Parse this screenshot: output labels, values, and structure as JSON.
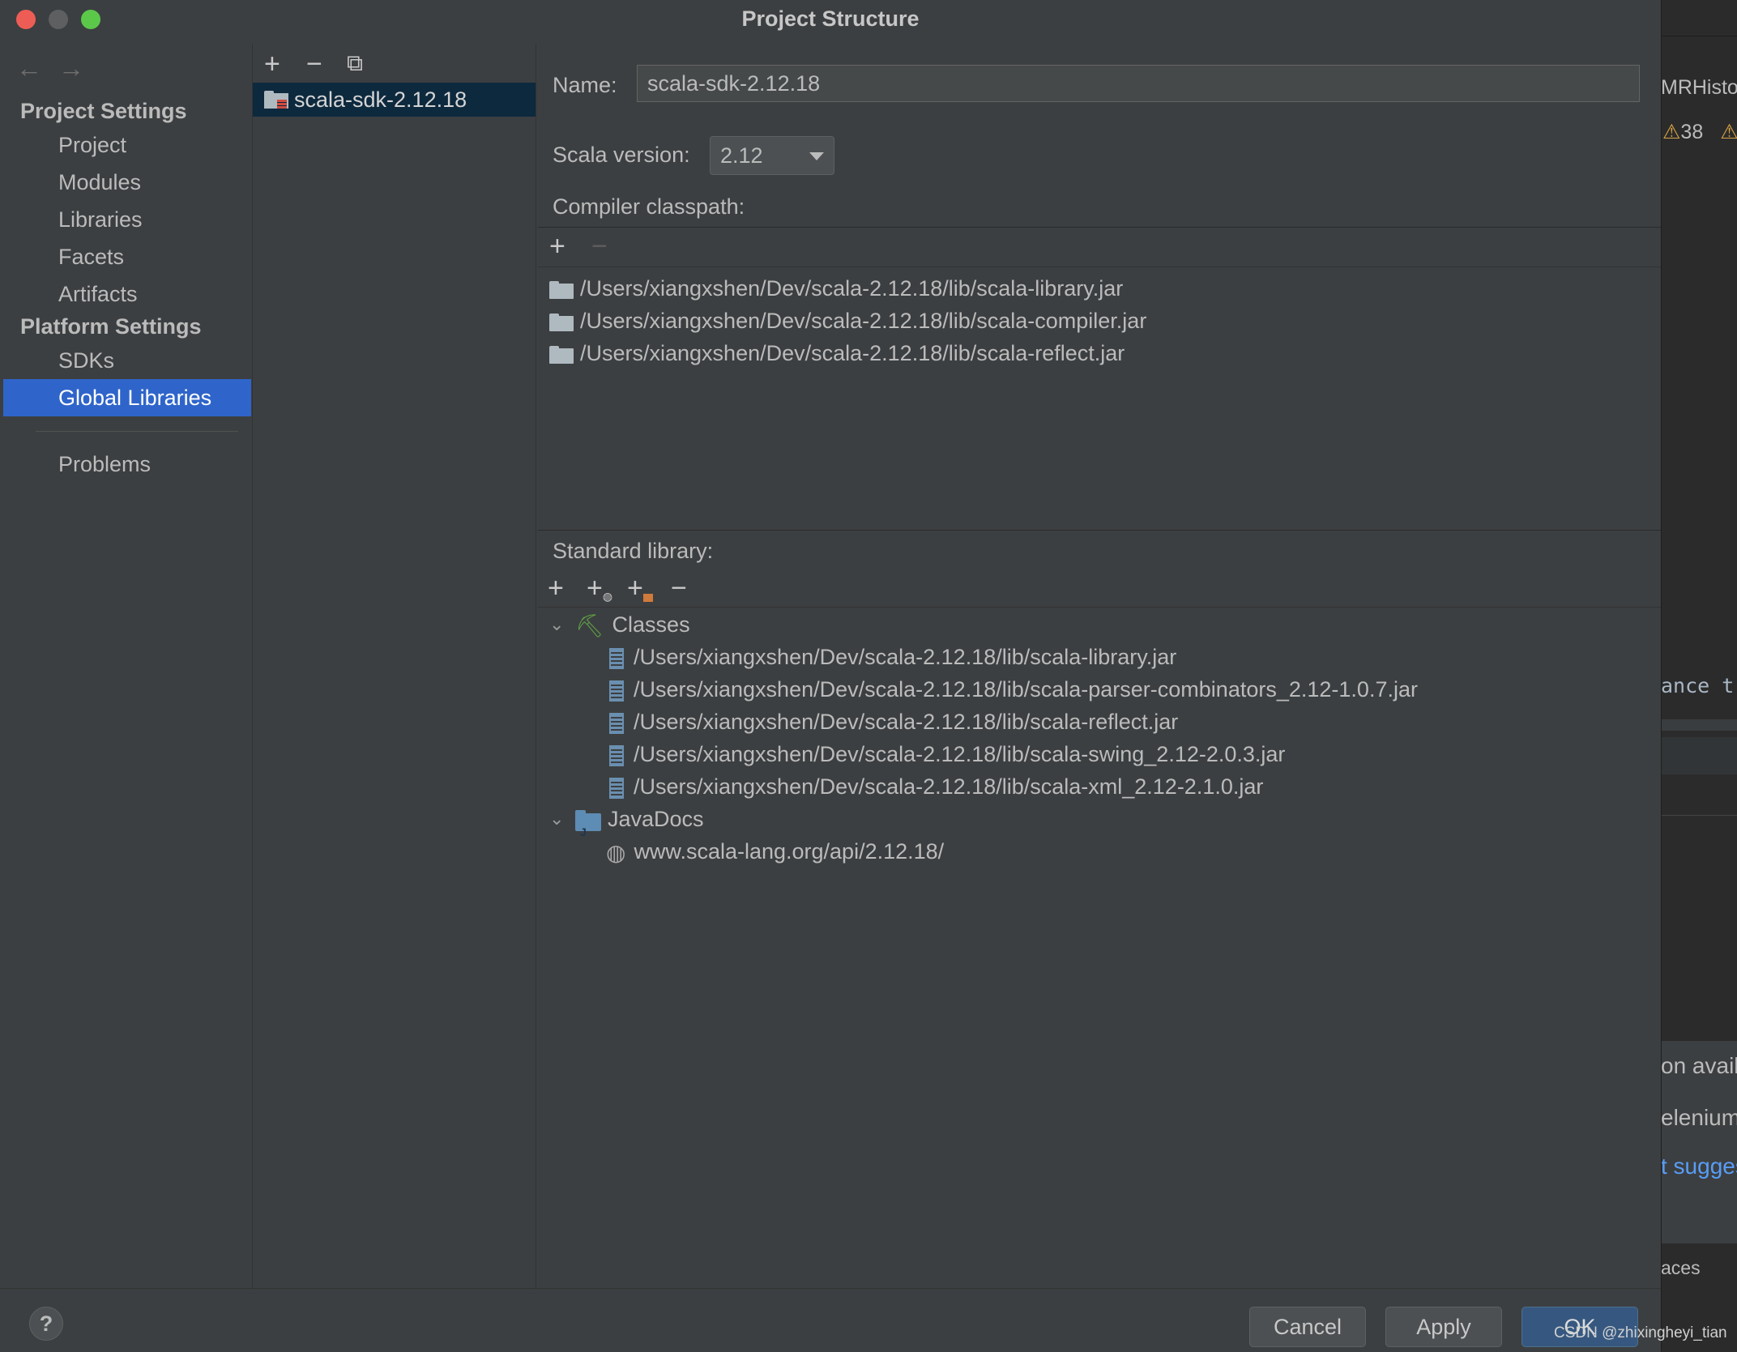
{
  "window": {
    "title": "Project Structure",
    "traffic_lights": {
      "close": "#ee5d55",
      "minimize": "#5d5f61",
      "zoom": "#5cc84a"
    }
  },
  "nav": {
    "back_icon": "←",
    "forward_icon": "→",
    "project_settings_header": "Project Settings",
    "project_items": [
      "Project",
      "Modules",
      "Libraries",
      "Facets",
      "Artifacts"
    ],
    "platform_settings_header": "Platform Settings",
    "platform_items": [
      "SDKs",
      "Global Libraries"
    ],
    "selected": "Global Libraries",
    "problems": "Problems"
  },
  "library_list": {
    "toolbar": {
      "add": "+",
      "remove": "−",
      "copy": "⧉"
    },
    "items": [
      "scala-sdk-2.12.18"
    ]
  },
  "details": {
    "name_label": "Name:",
    "name_value": "scala-sdk-2.12.18",
    "scala_version_label": "Scala version:",
    "scala_version_value": "2.12",
    "compiler_classpath_label": "Compiler classpath:",
    "compiler_classpath": [
      "/Users/xiangxshen/Dev/scala-2.12.18/lib/scala-library.jar",
      "/Users/xiangxshen/Dev/scala-2.12.18/lib/scala-compiler.jar",
      "/Users/xiangxshen/Dev/scala-2.12.18/lib/scala-reflect.jar"
    ],
    "standard_library_label": "Standard library:",
    "classes_label": "Classes",
    "classes": [
      "/Users/xiangxshen/Dev/scala-2.12.18/lib/scala-library.jar",
      "/Users/xiangxshen/Dev/scala-2.12.18/lib/scala-parser-combinators_2.12-1.0.7.jar",
      "/Users/xiangxshen/Dev/scala-2.12.18/lib/scala-reflect.jar",
      "/Users/xiangxshen/Dev/scala-2.12.18/lib/scala-swing_2.12-2.0.3.jar",
      "/Users/xiangxshen/Dev/scala-2.12.18/lib/scala-xml_2.12-2.1.0.jar"
    ],
    "javadocs_label": "JavaDocs",
    "javadocs": [
      "www.scala-lang.org/api/2.12.18/"
    ]
  },
  "buttons": {
    "help": "?",
    "cancel": "Cancel",
    "apply": "Apply",
    "ok": "OK"
  },
  "background_ide": {
    "tab_fragment": "MRHistor",
    "warning_count": "38",
    "code_fragment": "ance t",
    "notif_1": "on availa",
    "notif_2": "elenium",
    "notif_3": "t sugges",
    "status_fragment": "aces"
  },
  "watermark": "CSDN @zhixingheyi_tian",
  "colors": {
    "selection": "#2f65ca",
    "dialog_bg": "#3c3f41",
    "primary_button": "#365880"
  }
}
